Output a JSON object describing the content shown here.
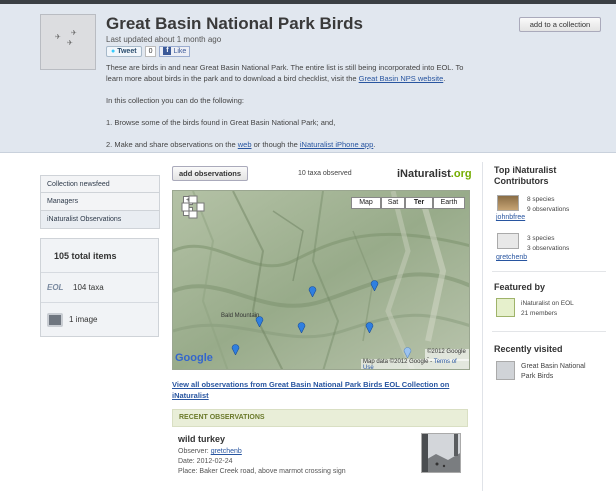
{
  "header": {
    "title": "Great Basin National Park Birds",
    "updated": "Last updated about 1 month ago",
    "tweet_label": "Tweet",
    "tweet_count": "0",
    "like_label": "Like",
    "add_collection": "add to a collection",
    "desc_p1_pre": "These are birds in and near Great Basin National Park. The entire list is still being incorporated into EOL. To learn more about birds in the park and to download a bird checklist, visit the ",
    "desc_p1_link": "Great Basin NPS website",
    "desc_p1_post": ".",
    "desc_p2": "In this collection you can do the following:",
    "desc_p3": "1. Browse some of the birds found in Great Basin National Park; and,",
    "desc_p4_pre": "2. Make and share observations on the ",
    "desc_p4_link1": "web",
    "desc_p4_mid": " or though the ",
    "desc_p4_link2": "iNaturalist iPhone app",
    "desc_p4_post": "."
  },
  "leftnav": {
    "items": [
      {
        "label": "Collection newsfeed"
      },
      {
        "label": "Managers"
      },
      {
        "label": "iNaturalist Observations"
      }
    ]
  },
  "stats": {
    "total": "105 total items",
    "taxa": "104 taxa",
    "taxa_icon_text": "EOL",
    "images": "1 image"
  },
  "center": {
    "add_observations": "add observations",
    "taxa_observed": "10 taxa observed",
    "logo_main": "iNaturalist",
    "logo_suffix": ".org",
    "map_types": [
      "Map",
      "Sat",
      "Ter",
      "Earth"
    ],
    "map_label": "Bald Mountain",
    "map_copyright": "©2012 Google -",
    "map_data": "Map data ©2012 Google -",
    "map_terms": "Terms of Use",
    "google_logo": "Google",
    "view_all": "View all observations from Great Basin National Park Birds EOL Collection on iNaturalist",
    "recent_header": "RECENT OBSERVATIONS",
    "obs_name": "wild turkey",
    "obs_observer_label": "Observer: ",
    "obs_observer": "gretchenb",
    "obs_date": "Date: 2012-02-24",
    "obs_place": "Place: Baker Creek road, above marmot crossing sign"
  },
  "right": {
    "contributors_title": "Top iNaturalist Contributors",
    "contributors": [
      {
        "name": "johnbfree",
        "species": "8 species",
        "observations": "9 observations"
      },
      {
        "name": "gretchenb",
        "species": "3 species",
        "observations": "3 observations"
      }
    ],
    "featured_title": "Featured by",
    "featured_name": "iNaturalist on EOL",
    "featured_members": "21 members",
    "recent_title": "Recently visited",
    "recent_item": "Great Basin National Park Birds"
  },
  "colors": {
    "header_bg": "#e1e7ef",
    "link": "#2855a0",
    "inat_green": "#74ac00",
    "pin": "#2f7fe0"
  }
}
